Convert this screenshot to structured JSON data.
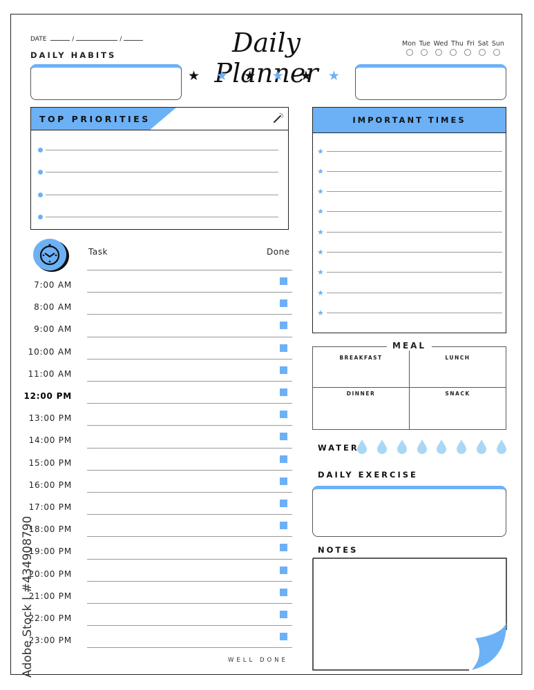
{
  "header": {
    "date_label": "DATE",
    "date_separator": "/",
    "title": "Daily Planner",
    "stars": [
      "black",
      "blue",
      "black",
      "blue",
      "black",
      "blue"
    ],
    "weekdays": [
      "Mon",
      "Tue",
      "Wed",
      "Thu",
      "Fri",
      "Sat",
      "Sun"
    ]
  },
  "habits": {
    "label": "DAILY HABITS"
  },
  "priorities": {
    "label": "TOP PRIORITIES",
    "icon": "magic-wand-icon",
    "line_count": 4
  },
  "important_times": {
    "label": "IMPORTANT TIMES",
    "line_count": 9
  },
  "schedule": {
    "icon": "clock-icon",
    "task_header": "Task",
    "done_header": "Done",
    "times": [
      {
        "label": "7:00 AM",
        "bold": false
      },
      {
        "label": "8:00 AM",
        "bold": false
      },
      {
        "label": "9:00 AM",
        "bold": false
      },
      {
        "label": "10:00 AM",
        "bold": false
      },
      {
        "label": "11:00 AM",
        "bold": false
      },
      {
        "label": "12:00 PM",
        "bold": true
      },
      {
        "label": "13:00 PM",
        "bold": false
      },
      {
        "label": "14:00 PM",
        "bold": false
      },
      {
        "label": "15:00 PM",
        "bold": false
      },
      {
        "label": "16:00 PM",
        "bold": false
      },
      {
        "label": "17:00 PM",
        "bold": false
      },
      {
        "label": "18:00 PM",
        "bold": false
      },
      {
        "label": "19:00 PM",
        "bold": false
      },
      {
        "label": "20:00 PM",
        "bold": false
      },
      {
        "label": "21:00 PM",
        "bold": false
      },
      {
        "label": "22:00 PM",
        "bold": false
      },
      {
        "label": "23:00 PM",
        "bold": false
      }
    ],
    "footer": "WELL DONE"
  },
  "meal": {
    "title": "MEAL",
    "cells": [
      "BREAKFAST",
      "LUNCH",
      "DINNER",
      "SNACK"
    ]
  },
  "water": {
    "label": "WATER",
    "drop_count": 8
  },
  "exercise": {
    "label": "DAILY EXERCISE"
  },
  "notes": {
    "label": "NOTES"
  },
  "watermark": {
    "text": "Adobe Stock | #434908790"
  },
  "colors": {
    "accent": "#6cb1f6",
    "water": "#a8d8f5",
    "ink": "#111111"
  }
}
